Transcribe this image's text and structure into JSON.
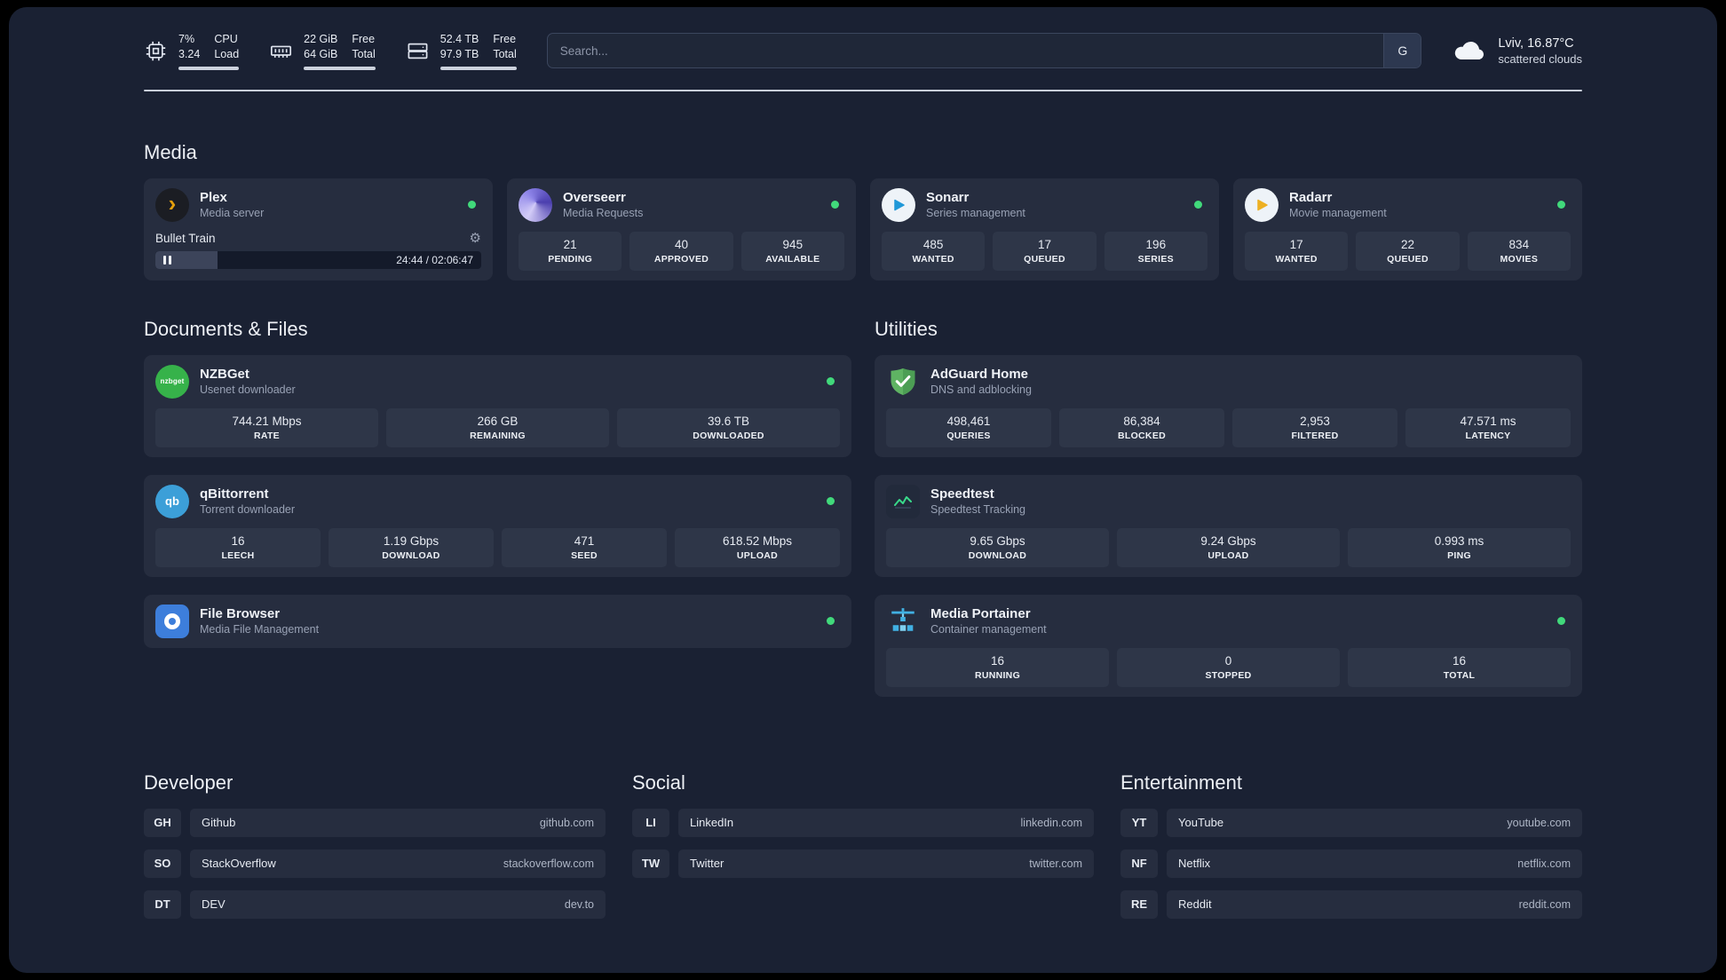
{
  "topbar": {
    "cpu": {
      "usage": "7%",
      "load": "3.24",
      "label_top": "CPU",
      "label_bottom": "Load"
    },
    "ram": {
      "free": "22 GiB",
      "total": "64 GiB",
      "label_top": "Free",
      "label_bottom": "Total"
    },
    "disk": {
      "free": "52.4 TB",
      "total": "97.9 TB",
      "label_top": "Free",
      "label_bottom": "Total"
    },
    "search": {
      "placeholder": "Search...",
      "provider_button": "G"
    },
    "weather": {
      "location": "Lviv, 16.87°C",
      "condition": "scattered clouds"
    }
  },
  "sections": {
    "media": "Media",
    "documents": "Documents & Files",
    "utilities": "Utilities",
    "developer": "Developer",
    "social": "Social",
    "entertainment": "Entertainment"
  },
  "apps": {
    "plex": {
      "name": "Plex",
      "subtitle": "Media server",
      "now_playing": "Bullet Train",
      "time": "24:44 / 02:06:47"
    },
    "overseerr": {
      "name": "Overseerr",
      "subtitle": "Media Requests",
      "stats": [
        {
          "value": "21",
          "label": "PENDING"
        },
        {
          "value": "40",
          "label": "APPROVED"
        },
        {
          "value": "945",
          "label": "AVAILABLE"
        }
      ]
    },
    "sonarr": {
      "name": "Sonarr",
      "subtitle": "Series management",
      "stats": [
        {
          "value": "485",
          "label": "WANTED"
        },
        {
          "value": "17",
          "label": "QUEUED"
        },
        {
          "value": "196",
          "label": "SERIES"
        }
      ]
    },
    "radarr": {
      "name": "Radarr",
      "subtitle": "Movie management",
      "stats": [
        {
          "value": "17",
          "label": "WANTED"
        },
        {
          "value": "22",
          "label": "QUEUED"
        },
        {
          "value": "834",
          "label": "MOVIES"
        }
      ]
    },
    "nzbget": {
      "name": "NZBGet",
      "subtitle": "Usenet downloader",
      "icon_text": "nzbget",
      "stats": [
        {
          "value": "744.21 Mbps",
          "label": "RATE"
        },
        {
          "value": "266 GB",
          "label": "REMAINING"
        },
        {
          "value": "39.6 TB",
          "label": "DOWNLOADED"
        }
      ]
    },
    "qbittorrent": {
      "name": "qBittorrent",
      "subtitle": "Torrent downloader",
      "icon_text": "qb",
      "stats": [
        {
          "value": "16",
          "label": "LEECH"
        },
        {
          "value": "1.19 Gbps",
          "label": "DOWNLOAD"
        },
        {
          "value": "471",
          "label": "SEED"
        },
        {
          "value": "618.52 Mbps",
          "label": "UPLOAD"
        }
      ]
    },
    "filebrowser": {
      "name": "File Browser",
      "subtitle": "Media File Management"
    },
    "adguard": {
      "name": "AdGuard Home",
      "subtitle": "DNS and adblocking",
      "stats": [
        {
          "value": "498,461",
          "label": "QUERIES"
        },
        {
          "value": "86,384",
          "label": "BLOCKED"
        },
        {
          "value": "2,953",
          "label": "FILTERED"
        },
        {
          "value": "47.571 ms",
          "label": "LATENCY"
        }
      ]
    },
    "speedtest": {
      "name": "Speedtest",
      "subtitle": "Speedtest Tracking",
      "stats": [
        {
          "value": "9.65 Gbps",
          "label": "DOWNLOAD"
        },
        {
          "value": "9.24 Gbps",
          "label": "UPLOAD"
        },
        {
          "value": "0.993 ms",
          "label": "PING"
        }
      ]
    },
    "portainer": {
      "name": "Media Portainer",
      "subtitle": "Container management",
      "stats": [
        {
          "value": "16",
          "label": "RUNNING"
        },
        {
          "value": "0",
          "label": "STOPPED"
        },
        {
          "value": "16",
          "label": "TOTAL"
        }
      ]
    }
  },
  "bookmarks": {
    "developer": [
      {
        "abbr": "GH",
        "name": "Github",
        "url": "github.com"
      },
      {
        "abbr": "SO",
        "name": "StackOverflow",
        "url": "stackoverflow.com"
      },
      {
        "abbr": "DT",
        "name": "DEV",
        "url": "dev.to"
      }
    ],
    "social": [
      {
        "abbr": "LI",
        "name": "LinkedIn",
        "url": "linkedin.com"
      },
      {
        "abbr": "TW",
        "name": "Twitter",
        "url": "twitter.com"
      }
    ],
    "entertainment": [
      {
        "abbr": "YT",
        "name": "YouTube",
        "url": "youtube.com"
      },
      {
        "abbr": "NF",
        "name": "Netflix",
        "url": "netflix.com"
      },
      {
        "abbr": "RE",
        "name": "Reddit",
        "url": "reddit.com"
      }
    ]
  },
  "colors": {
    "background": "#1a2133",
    "card": "#262d3f",
    "tile": "#2e3648",
    "status_online": "#41d97b",
    "plex_accent": "#e5a00d",
    "sonarr_blue": "#2098d8",
    "radarr_yellow": "#edb023",
    "nzbget_green": "#36b24a",
    "adguard_green": "#5fb363"
  }
}
